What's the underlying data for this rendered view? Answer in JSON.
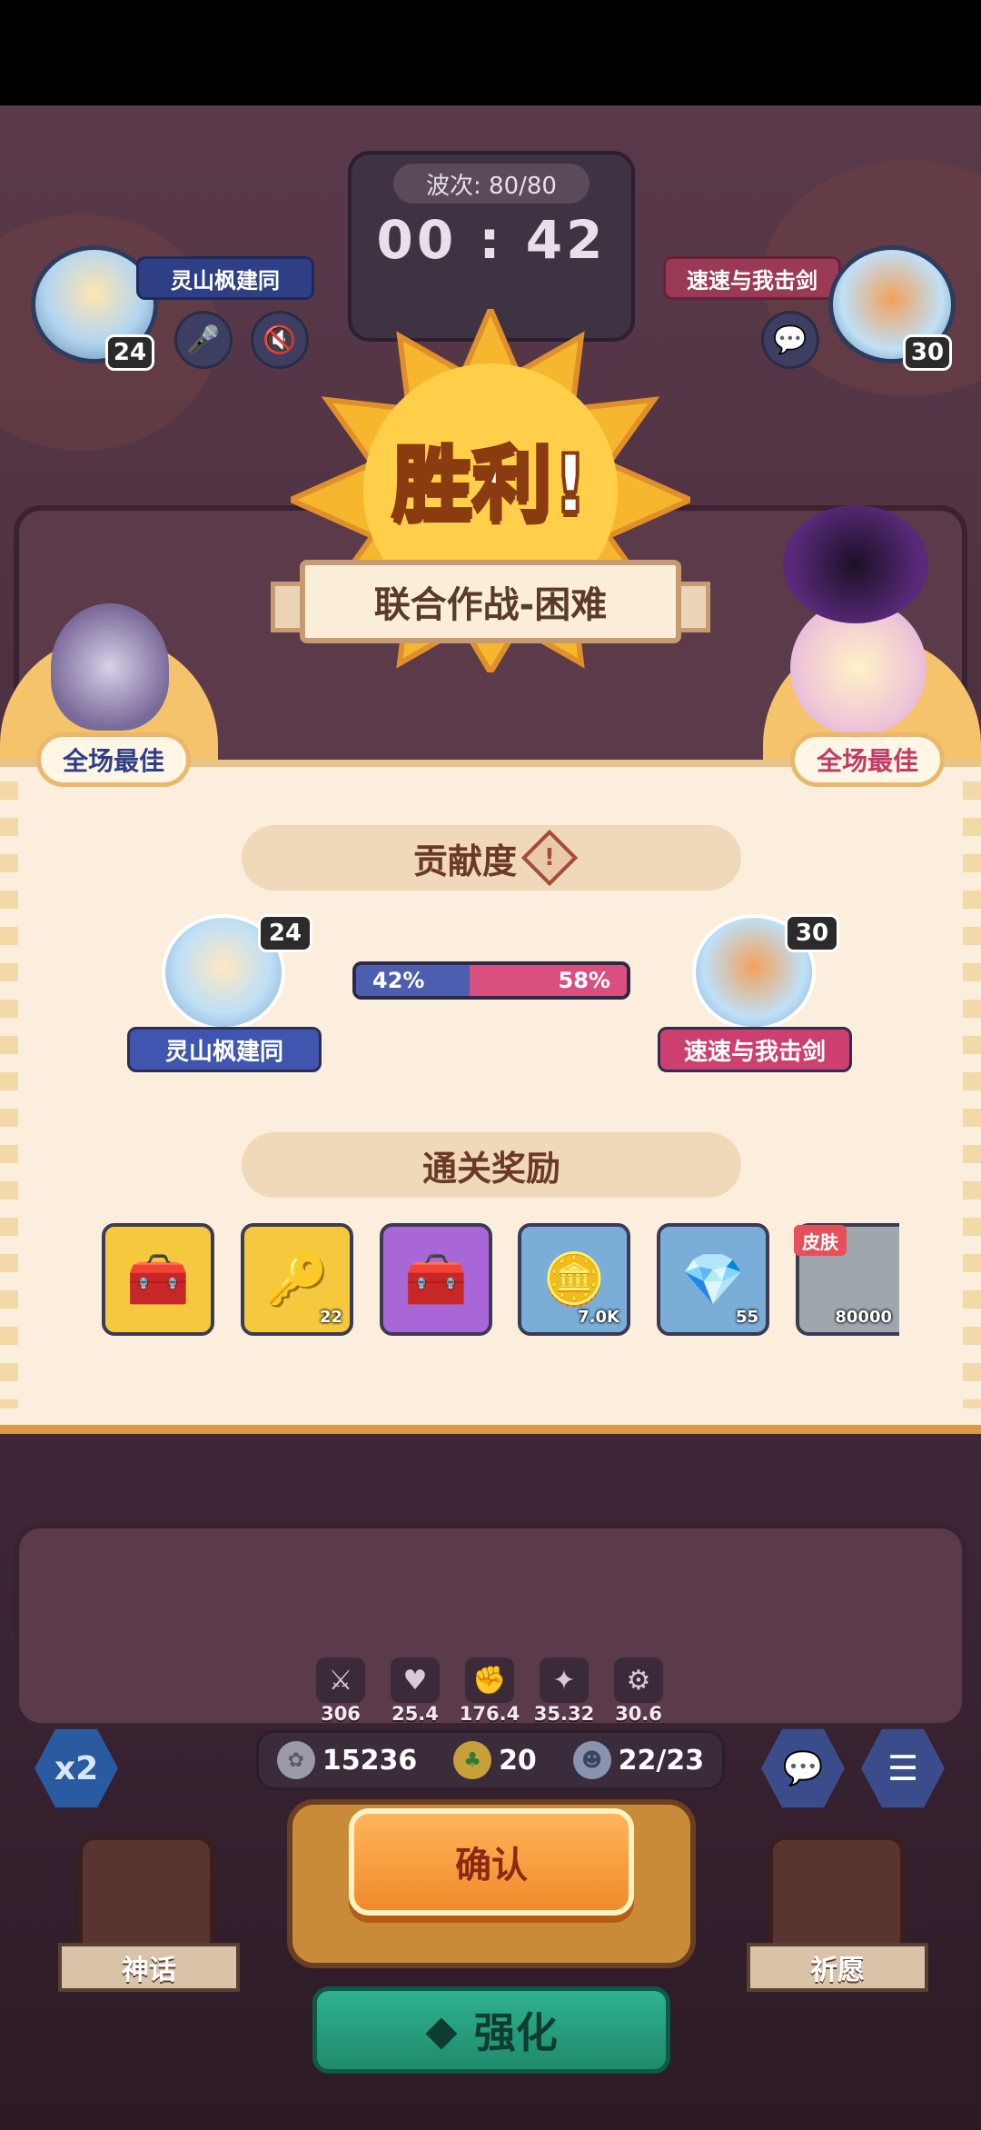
{
  "header": {
    "wave_label": "波次: 80/80",
    "timer": "00 : 42",
    "left_player": {
      "name": "灵山枫建同",
      "level": "24"
    },
    "right_player": {
      "name": "速速与我击剑",
      "level": "30"
    }
  },
  "result": {
    "title": "胜利!",
    "mode": "联合作战-困难",
    "mvp_left": "全场最佳",
    "mvp_right": "全场最佳"
  },
  "contribution": {
    "title": "贡献度",
    "info_icon": "!",
    "left_pct": "42%",
    "right_pct": "58%",
    "left_fraction": 0.42,
    "player_left": {
      "name": "灵山枫建同",
      "level": "24"
    },
    "player_right": {
      "name": "速速与我击剑",
      "level": "30"
    }
  },
  "rewards": {
    "title": "通关奖励",
    "skin_tag": "皮肤",
    "items": [
      {
        "icon": "gold-chest-icon",
        "count": ""
      },
      {
        "icon": "gold-key-icon",
        "count": "22"
      },
      {
        "icon": "purple-chest-icon",
        "count": ""
      },
      {
        "icon": "gold-coin-icon",
        "count": "7.0K"
      },
      {
        "icon": "purple-crystal-icon",
        "count": "55"
      },
      {
        "icon": "skin-icon",
        "count": "80000"
      }
    ]
  },
  "stats": [
    "306",
    "25.4",
    "176.4",
    "35.32",
    "30.6"
  ],
  "resources": {
    "silver": "15236",
    "clover": "20",
    "units": "22/23"
  },
  "buttons": {
    "speed": "x2",
    "confirm": "确认",
    "strengthen": "强化",
    "myth": "神话",
    "wish": "祈愿",
    "chat_icon": "chat-icon",
    "menu_icon": "menu-icon"
  },
  "colors": {
    "blue_team": "#4d5eb0",
    "pink_team": "#d94f7f",
    "accent": "#f08a2a",
    "panel": "#fbeedc"
  }
}
